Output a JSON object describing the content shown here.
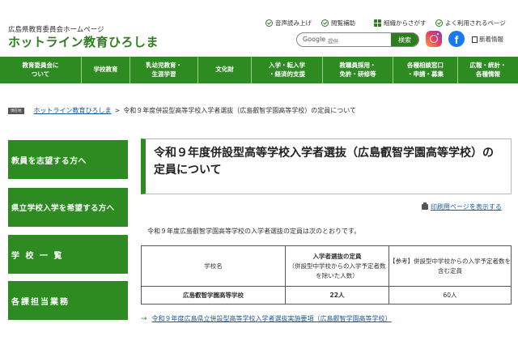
{
  "header": {
    "subtitle": "広島県教育委員会ホームページ",
    "site_title": "ホットライン教育ひろしま",
    "util": [
      "音声読み上げ",
      "閲覧補助",
      "組織からさがす",
      "よく利用されるページ"
    ],
    "search_engine": "Google",
    "search_placeholder": "提供",
    "search_button": "検索",
    "news_label": "新着情報",
    "facebook_glyph": "f",
    "brand_colors": {
      "instagram": "#e4405f",
      "facebook": "#1877f2"
    }
  },
  "nav": {
    "items": [
      {
        "l1": "教育委員会に",
        "l2": "ついて"
      },
      {
        "l1": "学校教育",
        "l2": ""
      },
      {
        "l1": "乳幼児教育・",
        "l2": "生涯学習"
      },
      {
        "l1": "文化財",
        "l2": ""
      },
      {
        "l1": "入学・転入学",
        "l2": "・経済的支援"
      },
      {
        "l1": "教職員採用・",
        "l2": "免許・研修等"
      },
      {
        "l1": "各種相談窓口",
        "l2": "・申請・募集"
      },
      {
        "l1": "広報・統計・",
        "l2": "各種情報"
      }
    ]
  },
  "breadcrumb": {
    "badge": "現在地",
    "home": "ホットライン教育ひろしま",
    "separator": ">",
    "current": "令和９年度併設型高等学校入学者選抜（広島叡智学園高等学校）の定員について"
  },
  "sidebar": {
    "items": [
      "教員を志望する方へ",
      "県立学校入学を希望する方へ",
      "学 校 一 覧",
      "各課担当業務"
    ]
  },
  "main": {
    "title": "令和９年度併設型高等学校入学者選抜（広島叡智学園高等学校）の定員について",
    "print_label": "印刷用ページを表示する",
    "intro": "令和９年度広島叡智学園高等学校の入学者選抜の定員は次のとおりです。",
    "table": {
      "header_school": "学校名",
      "header_quota_title": "入学者選抜の定員",
      "header_quota_note": "（併設型中学校からの入学予定者数を除いた人数）",
      "header_ref": "【参考】併設型中学校からの入学予定者数を含む定員",
      "rows": [
        {
          "school": "広島叡智学園高等学校",
          "quota": "22人",
          "ref": "60人"
        }
      ]
    },
    "link_arrow": "→",
    "link_text": "令和９年度広島県立併設型高等学校入学者選抜実施要項（広島叡智学園高等学校）"
  },
  "colors": {
    "accent_green": "#2e8b22",
    "link_blue": "#1a5a9a"
  }
}
